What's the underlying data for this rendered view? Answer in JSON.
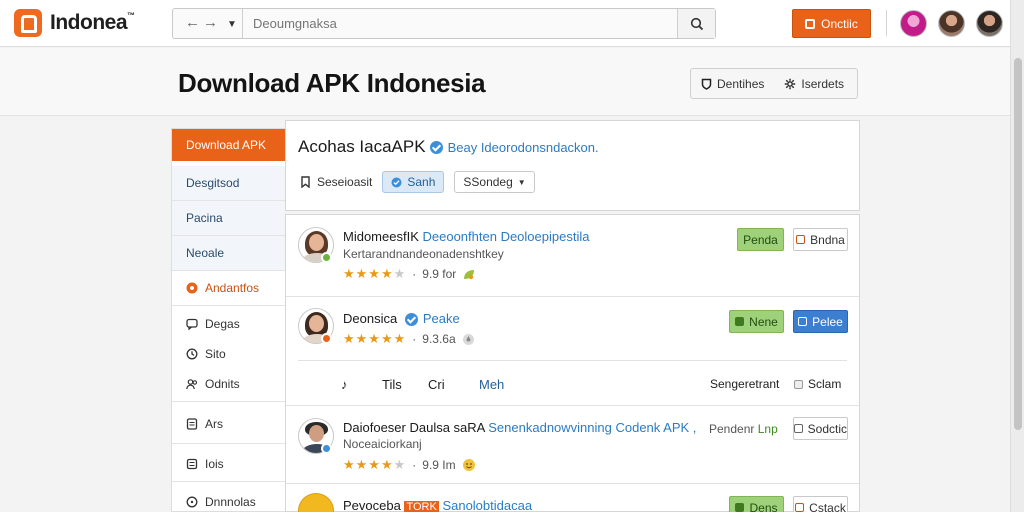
{
  "app": {
    "logo_text": "Indonea"
  },
  "search": {
    "placeholder": "Deoumgnaksa",
    "value": ""
  },
  "top_cta": {
    "label": "Onctiic"
  },
  "header": {
    "title": "Download APK Indonesia",
    "actions": [
      {
        "label": "Dentihes"
      },
      {
        "label": "Iserdets"
      }
    ]
  },
  "sidebar": {
    "items": [
      {
        "label": "Download APK",
        "active": true
      },
      {
        "label": "Desgitsod"
      },
      {
        "label": "Pacina"
      },
      {
        "label": "Neoale"
      },
      {
        "label": "Andantfos"
      },
      {
        "label": "Degas"
      },
      {
        "label": "Sito"
      },
      {
        "label": "Odnits"
      },
      {
        "label": "Ars"
      },
      {
        "label": "Iois"
      },
      {
        "label": "Dnnnolas"
      }
    ]
  },
  "filter": {
    "title": "Acohas IacaAPK",
    "subtitle": "Beay Ideorodonsndackon.",
    "label": "Seseioasit",
    "chip": "Sanh",
    "select": "SSondeg"
  },
  "apps": [
    {
      "name": "MidomeesfIK",
      "name_link": "Deeoonfhten Deoloepipestila",
      "desc": "Kertarandnandeonadenshtkey",
      "rating_text": "9.9 for",
      "stars": 4,
      "primary": "Penda",
      "secondary": "Bndna"
    },
    {
      "name": "Deonsica",
      "name_link": "Peake",
      "rating_text": "9.3.6a",
      "stars": 5,
      "primary": "Nene",
      "secondary": "Pelee"
    },
    {
      "name": "Daiofoeser Daulsa saRA",
      "name_link": "Senenkadnowvinning Codenk APK ,",
      "desc": "Noceaiciorkanj",
      "rating_text": "9.9 Im",
      "stars": 4,
      "note_prefix": "Pendenr",
      "note_green": "Lnp",
      "secondary": "Sodctic"
    },
    {
      "name": "Pevoceba",
      "name_tag": "TORK",
      "name_link": "Sanolobtidacaa",
      "primary": "Dens",
      "secondary": "Cstack"
    }
  ],
  "tabs": {
    "items": [
      {
        "label": "Tils"
      },
      {
        "label": "Cri"
      },
      {
        "label": "Meh"
      }
    ],
    "right_label": "Sengeretrant",
    "right_action": "Sclam"
  },
  "colors": {
    "brand_orange": "#e8621a",
    "link_blue": "#2b7bc4",
    "button_green": "#9fd07a",
    "button_blue": "#3c7fd0"
  }
}
